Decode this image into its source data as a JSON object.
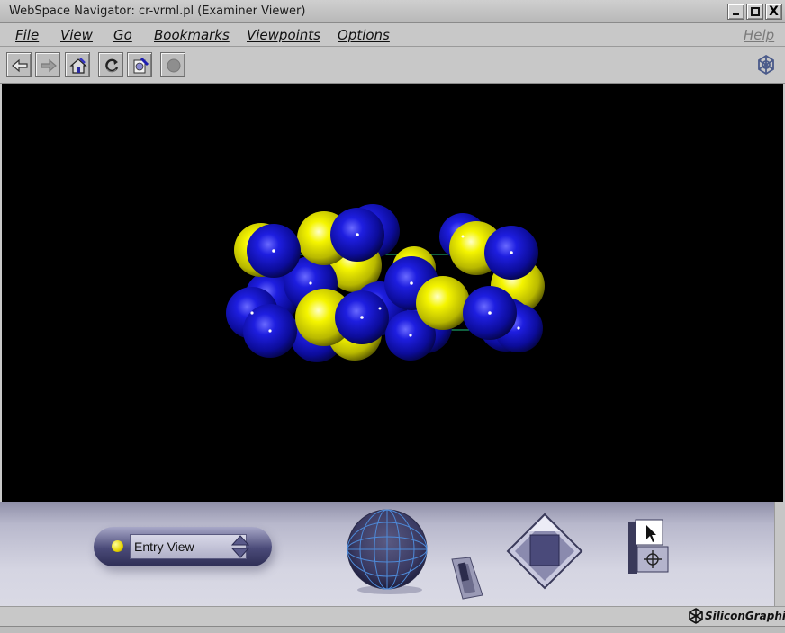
{
  "window": {
    "title": "WebSpace Navigator: cr-vrml.pl (Examiner Viewer)",
    "controls": [
      "minimize-icon",
      "maximize-icon",
      "close-icon"
    ],
    "close_glyph": "X"
  },
  "menubar": {
    "items": [
      {
        "label": "File"
      },
      {
        "label": "View"
      },
      {
        "label": "Go"
      },
      {
        "label": "Bookmarks"
      },
      {
        "label": "Viewpoints"
      },
      {
        "label": "Options"
      }
    ],
    "help": "Help"
  },
  "toolbar": {
    "buttons": [
      {
        "icon": "back-arrow-icon",
        "enabled": true
      },
      {
        "icon": "forward-arrow-icon",
        "enabled": false
      },
      {
        "icon": "home-icon",
        "enabled": true
      },
      {
        "icon": "reload-icon",
        "enabled": true
      },
      {
        "icon": "edit-document-icon",
        "enabled": true
      },
      {
        "icon": "stop-icon",
        "enabled": false
      }
    ],
    "right_icon": "sgi-cube-icon"
  },
  "viewport": {
    "background": "#000000",
    "scene": "molecule-model",
    "atom_colors": {
      "blue": "#1a1acc",
      "yellow": "#e6e600"
    },
    "bounding_box_color": "#1fbf7a"
  },
  "controls": {
    "viewpoint": {
      "label": "Entry View"
    },
    "tools": [
      "trackball-icon",
      "dolly-slider-icon",
      "pan-diamond-icon",
      "pointer-select-icon",
      "move-icon"
    ]
  },
  "status": {
    "brand": "SiliconGraphics"
  }
}
